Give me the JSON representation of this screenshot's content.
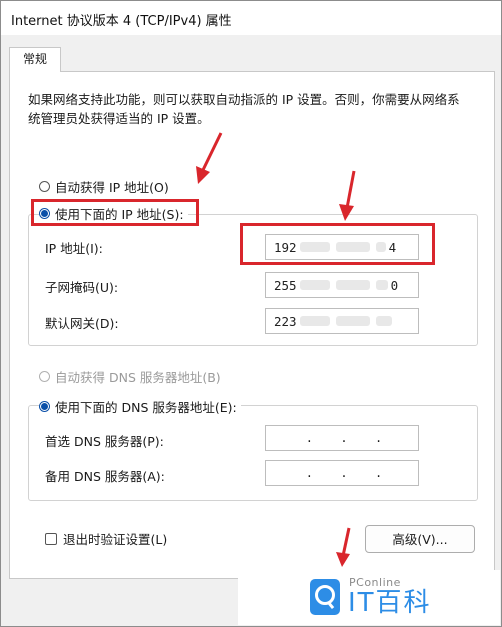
{
  "window": {
    "title": "Internet 协议版本 4 (TCP/IPv4) 属性"
  },
  "tabs": [
    {
      "label": "常规",
      "active": true
    }
  ],
  "general": {
    "description": "如果网络支持此功能，则可以获取自动指派的 IP 设置。否则，你需要从网络系统管理员处获得适当的 IP 设置。",
    "ip_mode": {
      "auto_label": "自动获得 IP 地址(O)",
      "manual_label": "使用下面的 IP 地址(S):",
      "selected": "manual"
    },
    "ip_fields": {
      "ip_address": {
        "label": "IP 地址(I):",
        "value_prefix": "192",
        "value_suffix": "4"
      },
      "subnet_mask": {
        "label": "子网掩码(U):",
        "value_prefix": "255",
        "value_suffix": "0"
      },
      "default_gateway": {
        "label": "默认网关(D):",
        "value_prefix": "223",
        "value_suffix": ""
      }
    },
    "dns_mode": {
      "auto_label": "自动获得 DNS 服务器地址(B)",
      "manual_label": "使用下面的 DNS 服务器地址(E):",
      "selected": "manual",
      "auto_disabled": true
    },
    "dns_fields": {
      "preferred": {
        "label": "首选 DNS 服务器(P):",
        "value": ""
      },
      "alternate": {
        "label": "备用 DNS 服务器(A):",
        "value": ""
      }
    },
    "validate_checkbox": {
      "label": "退出时验证设置(L)",
      "checked": false
    },
    "advanced_button": {
      "label": "高级(V)..."
    }
  },
  "watermark": {
    "brand_small": "PConline",
    "brand_big": "IT百科"
  },
  "colors": {
    "accent_blue": "#0a4fa8",
    "annotation_red": "#d9262c",
    "watermark_blue": "#2d8de6"
  }
}
